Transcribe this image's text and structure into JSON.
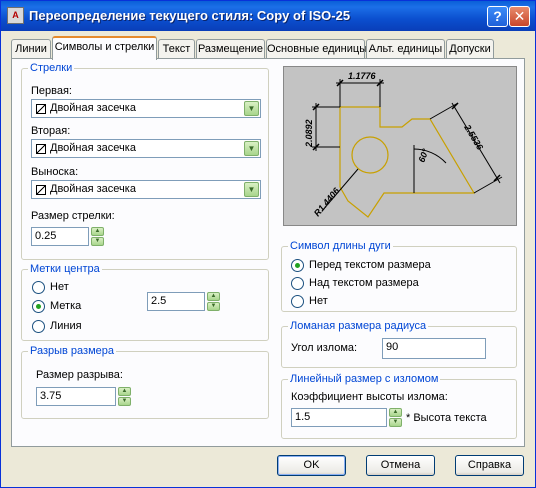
{
  "window": {
    "title": "Переопределение текущего стиля: Copy of ISO-25",
    "help_label": "?",
    "close_label": "✕",
    "app_icon": "acad-icon"
  },
  "tabs": [
    {
      "label": "Линии",
      "active": false
    },
    {
      "label": "Символы и стрелки",
      "active": true
    },
    {
      "label": "Текст",
      "active": false
    },
    {
      "label": "Размещение",
      "active": false
    },
    {
      "label": "Основные единицы",
      "active": false
    },
    {
      "label": "Альт. единицы",
      "active": false
    },
    {
      "label": "Допуски",
      "active": false
    }
  ],
  "arrows": {
    "title": "Стрелки",
    "first_label": "Первая:",
    "first_value": "Двойная засечка",
    "second_label": "Вторая:",
    "second_value": "Двойная засечка",
    "leader_label": "Выноска:",
    "leader_value": "Двойная засечка",
    "size_label": "Размер стрелки:",
    "size_value": "0.25"
  },
  "center_marks": {
    "title": "Метки центра",
    "options": [
      {
        "label": "Нет",
        "checked": false
      },
      {
        "label": "Метка",
        "checked": true
      },
      {
        "label": "Линия",
        "checked": false
      }
    ],
    "size_value": "2.5"
  },
  "dim_break": {
    "title": "Разрыв размера",
    "size_label": "Размер разрыва:",
    "size_value": "3.75"
  },
  "preview": {
    "dim_top": "1.1776",
    "dim_left": "2.0892",
    "dim_right": "2.5536",
    "dim_angle": "60°",
    "dim_radius": "R1.4406"
  },
  "arc_length": {
    "title": "Символ длины дуги",
    "options": [
      {
        "label": "Перед текстом размера",
        "checked": true
      },
      {
        "label": "Над текстом размера",
        "checked": false
      },
      {
        "label": "Нет",
        "checked": false
      }
    ]
  },
  "jog_radius": {
    "title": "Ломаная размера радиуса",
    "angle_label": "Угол излома:",
    "angle_value": "90"
  },
  "linear_jog": {
    "title": "Линейный размер с изломом",
    "factor_label": "Коэффициент высоты излома:",
    "factor_value": "1.5",
    "factor_suffix": "* Высота текста"
  },
  "buttons": {
    "ok": "OK",
    "cancel": "Отмена",
    "help": "Справка"
  },
  "colors": {
    "titlebar": "#0a5fd8",
    "group_title": "#0046d5",
    "preview_bg": "#c3c3c3",
    "preview_geometry": "#c8a000"
  }
}
